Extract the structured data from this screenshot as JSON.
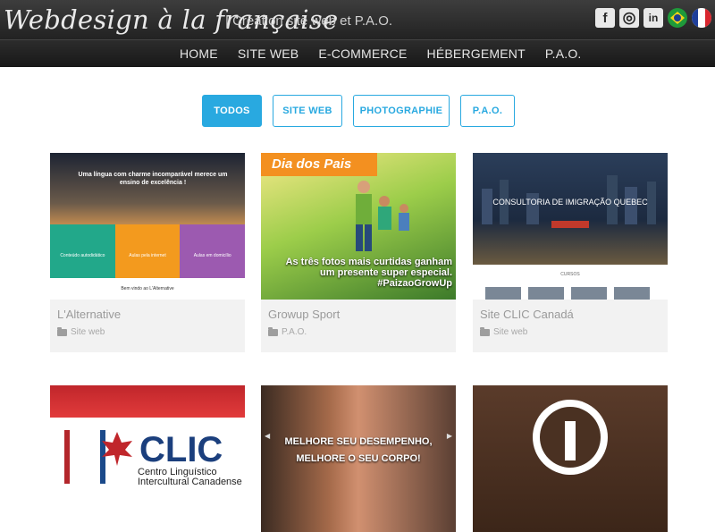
{
  "header": {
    "brand": "Webdesign à la française",
    "tagline": "| Création site web et P.A.O.",
    "social": [
      "facebook-icon",
      "instagram-icon",
      "linkedin-icon",
      "brazil-flag-icon",
      "france-flag-icon"
    ],
    "social_glyphs": [
      "f",
      "◎",
      "in"
    ]
  },
  "nav": [
    "HOME",
    "SITE WEB",
    "E-COMMERCE",
    "HÉBERGEMENT",
    "P.A.O."
  ],
  "filters": [
    "TODOS",
    "SITE WEB",
    "PHOTOGRAPHIE",
    "P.A.O."
  ],
  "colors": {
    "accent": "#29a9e0",
    "header_bg": "#222222"
  },
  "portfolio": [
    {
      "title": "L'Alternative",
      "category": "Site web",
      "thumb": {
        "heading": "Uma língua com charme incomparável merece um ensino de excelência !",
        "tiles": [
          "Conteúdo autodidático",
          "Aulas pela internet",
          "Aulas em domicílio"
        ],
        "footer": "Bem vindo ao L'Alternative"
      }
    },
    {
      "title": "Growup Sport",
      "category": "P.A.O.",
      "thumb": {
        "band": "Dia dos Pais",
        "text": "As três fotos mais curtidas ganham um presente super especial. #PaizaoGrowUp"
      }
    },
    {
      "title": "Site CLIC Canadá",
      "category": "Site web",
      "thumb": {
        "heading": "CONSULTORIA DE IMIGRAÇÃO QUEBEC",
        "section": "CURSOS"
      }
    },
    {
      "thumb": {
        "logo": "CLIC",
        "sub1": "Centro Linguístico",
        "sub2": "Intercultural Canadense"
      }
    },
    {
      "thumb": {
        "line1": "MELHORE SEU DESEMPENHO,",
        "line2": "MELHORE O SEU CORPO!"
      }
    },
    {
      "thumb": {}
    }
  ]
}
